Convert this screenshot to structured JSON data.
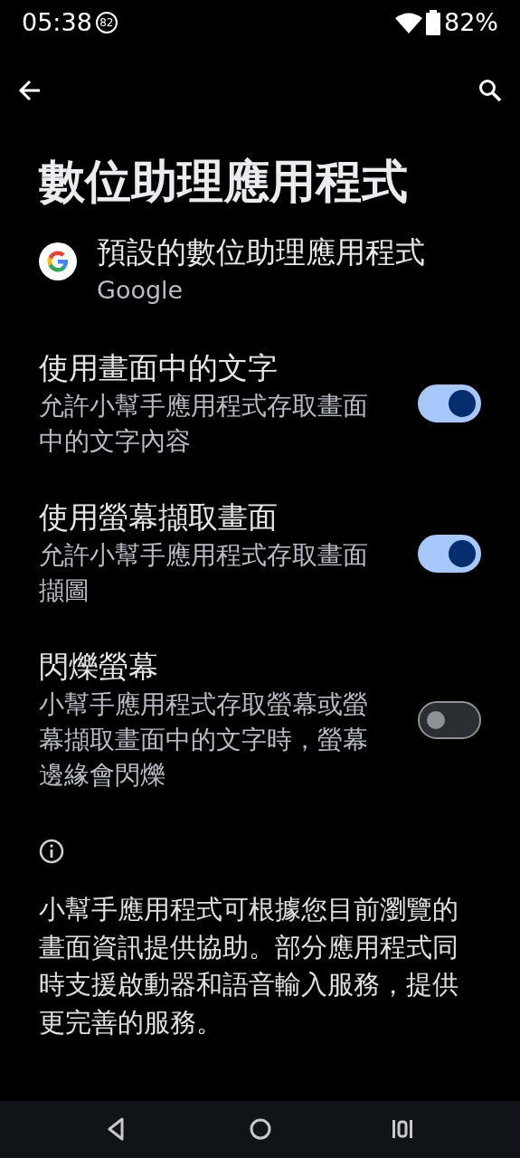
{
  "status_bar": {
    "time": "05:38",
    "notification_badge": "82",
    "battery_percent": "82%"
  },
  "title": "數位助理應用程式",
  "default_app": {
    "title": "預設的數位助理應用程式",
    "value": "Google"
  },
  "settings": [
    {
      "title": "使用畫面中的文字",
      "summary": "允許小幫手應用程式存取畫面中的文字內容",
      "on": true
    },
    {
      "title": "使用螢幕擷取畫面",
      "summary": "允許小幫手應用程式存取畫面擷圖",
      "on": true
    },
    {
      "title": "閃爍螢幕",
      "summary": "小幫手應用程式存取螢幕或螢幕擷取畫面中的文字時，螢幕邊緣會閃爍",
      "on": false
    }
  ],
  "footer_text": "小幫手應用程式可根據您目前瀏覽的畫面資訊提供協助。部分應用程式同時支援啟動器和語音輸入服務，提供更完善的服務。"
}
